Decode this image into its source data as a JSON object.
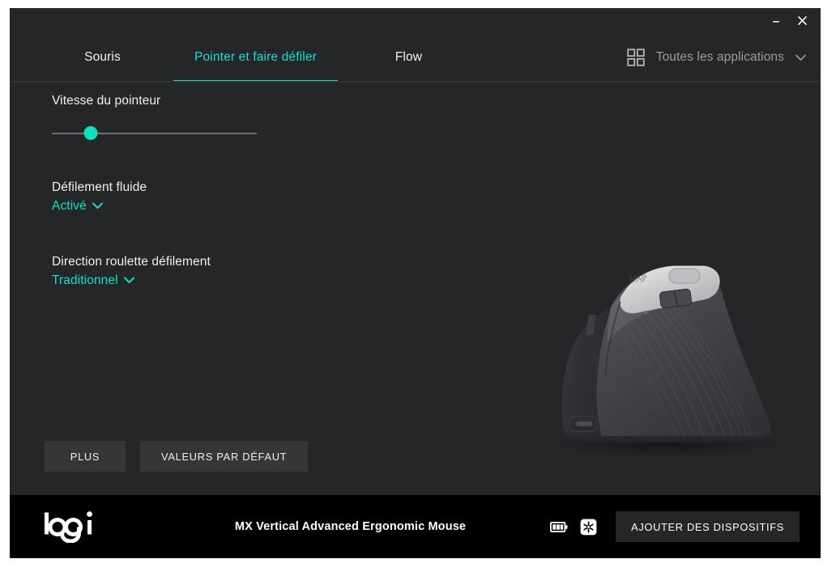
{
  "window": {
    "minimize_label": "–",
    "close_label": "×",
    "accent_color": "#14e0c8",
    "background_color": "#242628",
    "footer_color": "#000000"
  },
  "tabs": [
    {
      "label": "Souris",
      "active": false
    },
    {
      "label": "Pointer et faire défiler",
      "active": true
    },
    {
      "label": "Flow",
      "active": false
    }
  ],
  "header": {
    "apps_icon": "grid-icon",
    "apps_label": "Toutes les applications",
    "apps_chevron": "chevron-down-icon"
  },
  "settings": {
    "pointer_speed": {
      "label": "Vitesse du pointeur",
      "value_percent": 19
    },
    "smooth_scrolling": {
      "label": "Défilement fluide",
      "value": "Activé"
    },
    "scroll_direction": {
      "label": "Direction roulette défilement",
      "value": "Traditionnel"
    }
  },
  "actions": {
    "more_label": "PLUS",
    "defaults_label": "VALEURS PAR DÉFAUT"
  },
  "product": {
    "image_alt": "MX Vertical Advanced Ergonomic Mouse",
    "logo_text": "logi"
  },
  "footer": {
    "brand_logo": "logi",
    "device_name": "MX Vertical Advanced Ergonomic Mouse",
    "battery_icon": "battery-full-icon",
    "receiver_icon": "unifying-receiver-icon",
    "add_devices_label": "AJOUTER DES DISPOSITIFS"
  }
}
